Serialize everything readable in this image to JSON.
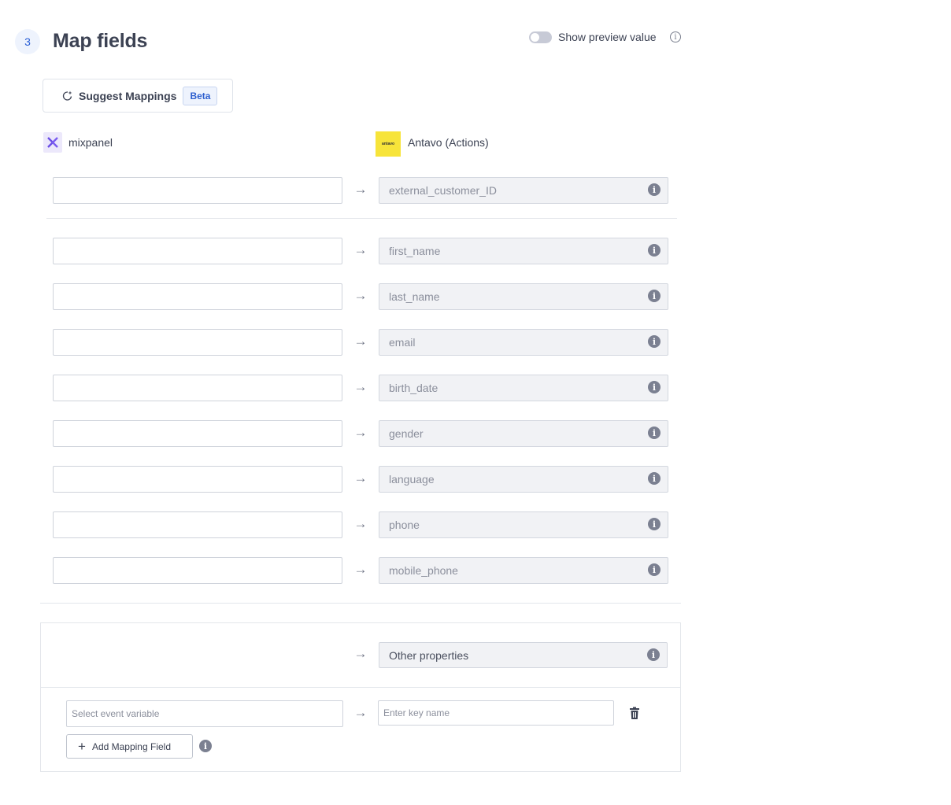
{
  "step": {
    "number": "3",
    "title": "Map fields"
  },
  "preview_toggle": {
    "label": "Show preview value",
    "enabled": false
  },
  "suggest": {
    "label": "Suggest Mappings",
    "badge": "Beta"
  },
  "source": {
    "name": "mixpanel",
    "icon": "mixpanel-logo"
  },
  "destination": {
    "name": "Antavo (Actions)",
    "logo_text": "antavo",
    "brand_color": "#f7e43a"
  },
  "mappings": [
    {
      "source_value": "",
      "destination_field": "external_customer_ID"
    },
    {
      "source_value": "",
      "destination_field": "first_name"
    },
    {
      "source_value": "",
      "destination_field": "last_name"
    },
    {
      "source_value": "",
      "destination_field": "email"
    },
    {
      "source_value": "",
      "destination_field": "birth_date"
    },
    {
      "source_value": "",
      "destination_field": "gender"
    },
    {
      "source_value": "",
      "destination_field": "language"
    },
    {
      "source_value": "",
      "destination_field": "phone"
    },
    {
      "source_value": "",
      "destination_field": "mobile_phone"
    }
  ],
  "other_properties": {
    "destination_field": "Other properties",
    "variable_placeholder": "Select event variable",
    "key_placeholder": "Enter key name",
    "add_button_label": "Add Mapping Field"
  },
  "colors": {
    "accent": "#2a5fd6",
    "text": "#3c4253",
    "muted": "#8b8f9c"
  }
}
